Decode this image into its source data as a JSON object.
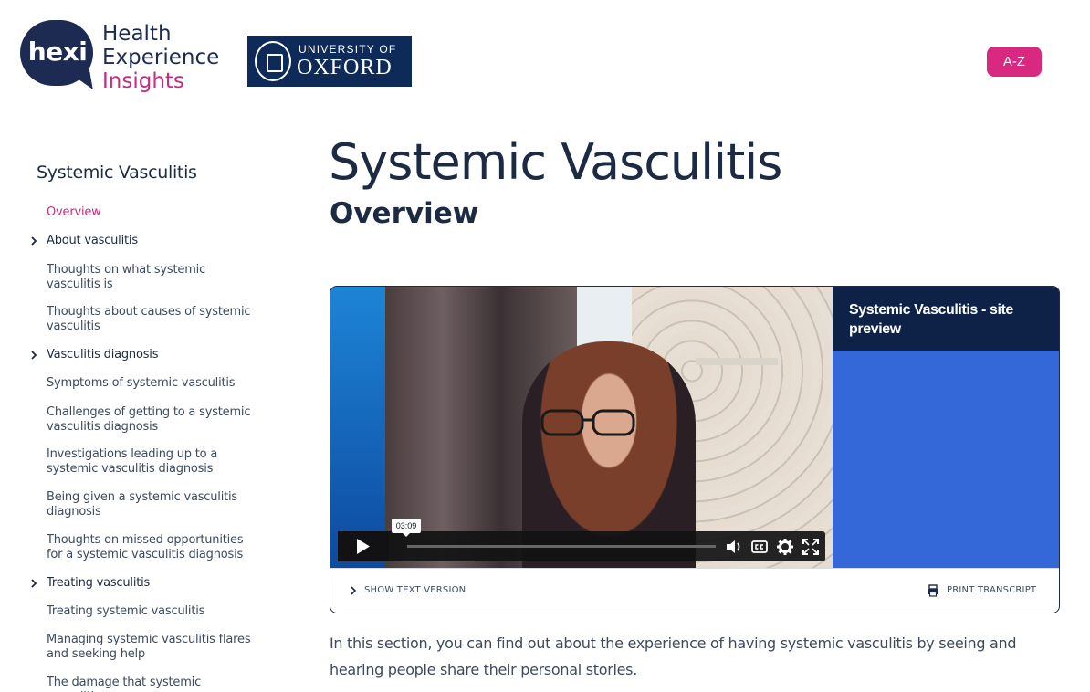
{
  "header": {
    "hexi_logo": {
      "mark": "hexi",
      "line1": "Health",
      "line2": "Experience",
      "line3": "Insights"
    },
    "oxford_logo": {
      "line1": "UNIVERSITY OF",
      "line2": "OXFORD"
    },
    "az_label": "A-Z"
  },
  "sidebar": {
    "title": "Systemic Vasculitis",
    "items": [
      {
        "label": "Overview",
        "type": "active"
      },
      {
        "label": "About vasculitis",
        "type": "section"
      },
      {
        "label": "Thoughts on what systemic vasculitis is",
        "type": "link"
      },
      {
        "label": "Thoughts about causes of systemic vasculitis",
        "type": "link"
      },
      {
        "label": "Vasculitis diagnosis",
        "type": "section"
      },
      {
        "label": "Symptoms of systemic vasculitis",
        "type": "link"
      },
      {
        "label": "Challenges of getting to a systemic vasculitis diagnosis",
        "type": "link"
      },
      {
        "label": "Investigations leading up to a systemic vasculitis diagnosis",
        "type": "link"
      },
      {
        "label": "Being given a systemic vasculitis diagnosis",
        "type": "link"
      },
      {
        "label": "Thoughts on missed opportunities for a systemic vasculitis diagnosis",
        "type": "link"
      },
      {
        "label": "Treating vasculitis",
        "type": "section"
      },
      {
        "label": "Treating systemic vasculitis",
        "type": "link"
      },
      {
        "label": "Managing systemic vasculitis flares and seeking help",
        "type": "link"
      },
      {
        "label": "The damage that systemic vasculitis",
        "type": "link"
      }
    ]
  },
  "main": {
    "title": "Systemic Vasculitis",
    "subtitle": "Overview",
    "video": {
      "panel_title": "Systemic Vasculitis - site preview",
      "time_tooltip": "03:09",
      "show_text_label": "SHOW TEXT VERSION",
      "print_label": "PRINT TRANSCRIPT"
    },
    "intro": "In this section, you can find out about the experience of having systemic vasculitis by seeing and hearing people share their personal stories."
  },
  "colors": {
    "brand_navy": "#1d2b53",
    "brand_pink": "#d8287f",
    "oxford_blue": "#0e2a59",
    "video_panel_blue": "#3467d8"
  }
}
